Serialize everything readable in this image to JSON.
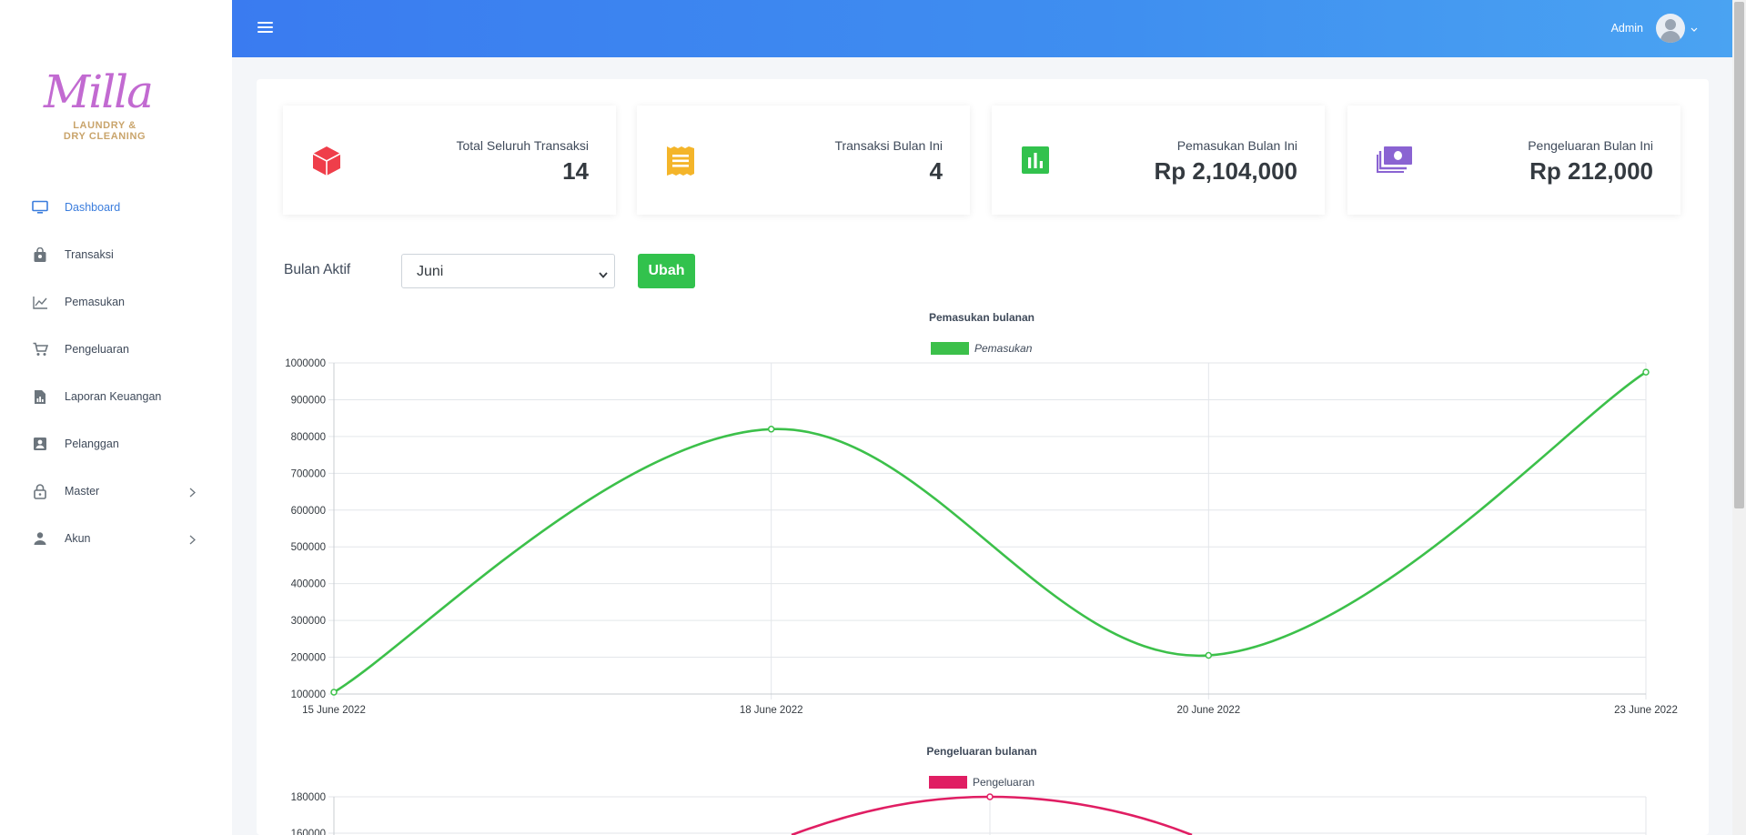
{
  "brand": {
    "logo_script": "Milla",
    "logo_line1": "LAUNDRY &",
    "logo_line2": "DRY CLEANING"
  },
  "sidebar": {
    "items": [
      {
        "label": "Dashboard",
        "icon": "monitor-icon",
        "active": true
      },
      {
        "label": "Transaksi",
        "icon": "shopping-bag-icon"
      },
      {
        "label": "Pemasukan",
        "icon": "line-chart-icon"
      },
      {
        "label": "Pengeluaran",
        "icon": "cart-icon"
      },
      {
        "label": "Laporan Keuangan",
        "icon": "file-report-icon"
      },
      {
        "label": "Pelanggan",
        "icon": "contact-card-icon"
      },
      {
        "label": "Master",
        "icon": "lock-icon",
        "has_submenu": true
      },
      {
        "label": "Akun",
        "icon": "user-icon",
        "has_submenu": true
      }
    ]
  },
  "topbar": {
    "user_name": "Admin"
  },
  "stats": [
    {
      "title": "Total Seluruh Transaksi",
      "value": "14",
      "icon": "cube-icon",
      "color": "#ef3e4a"
    },
    {
      "title": "Transaksi Bulan Ini",
      "value": "4",
      "icon": "receipt-icon",
      "color": "#f4b52a"
    },
    {
      "title": "Pemasukan Bulan Ini",
      "value": "Rp 2,104,000",
      "icon": "bar-chart-icon",
      "color": "#32c24d"
    },
    {
      "title": "Pengeluaran Bulan Ini",
      "value": "Rp 212,000",
      "icon": "money-icon",
      "color": "#8a63d2"
    }
  ],
  "filter": {
    "label": "Bulan Aktif",
    "selected": "Juni",
    "button": "Ubah"
  },
  "chart_data": [
    {
      "type": "line",
      "title": "Pemasukan bulanan",
      "x": [
        "15 June 2022",
        "18 June 2022",
        "20 June 2022",
        "23 June 2022"
      ],
      "series": [
        {
          "name": "Pemasukan",
          "values": [
            105000,
            820000,
            205000,
            975000
          ],
          "color": "#3cc04a"
        }
      ],
      "yticks": [
        "1000000",
        "900000",
        "800000",
        "700000",
        "600000",
        "500000",
        "400000",
        "300000",
        "200000",
        "100000"
      ],
      "ylim": [
        100000,
        1000000
      ],
      "grid": true,
      "legend": "top-center"
    },
    {
      "type": "line",
      "title": "Pengeluaran bulanan",
      "series": [
        {
          "name": "Pengeluaran",
          "color": "#e01e63"
        }
      ],
      "yticks": [
        "180000",
        "160000"
      ],
      "grid": true,
      "legend": "top-center"
    }
  ]
}
